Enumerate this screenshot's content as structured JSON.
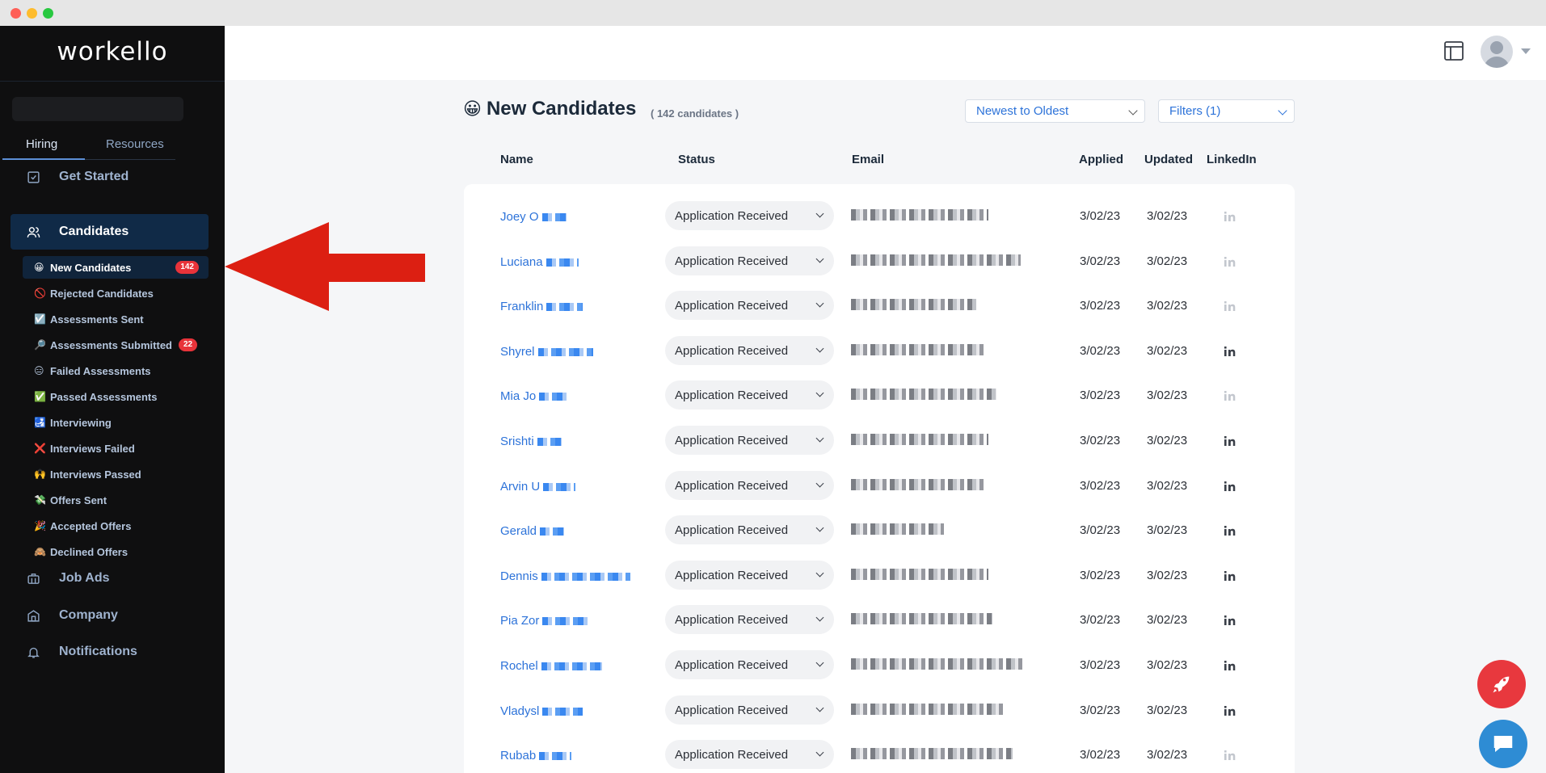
{
  "app": {
    "logo": "workello"
  },
  "sidebar": {
    "tabs": [
      {
        "label": "Hiring",
        "active": true
      },
      {
        "label": "Resources",
        "active": false
      }
    ],
    "nav": {
      "get_started": "Get Started",
      "candidates": "Candidates",
      "job_ads": "Job Ads",
      "company": "Company",
      "notifications": "Notifications"
    },
    "candidate_filters": [
      {
        "emoji": "😀",
        "label": "New Candidates",
        "badge": "142",
        "active": true
      },
      {
        "emoji": "🚫",
        "label": "Rejected Candidates",
        "badge": null
      },
      {
        "emoji": "☑️",
        "label": "Assessments Sent",
        "badge": null
      },
      {
        "emoji": "🔎",
        "label": "Assessments Submitted",
        "badge": "22"
      },
      {
        "emoji": "😑",
        "label": "Failed Assessments",
        "badge": null
      },
      {
        "emoji": "✅",
        "label": "Passed Assessments",
        "badge": null
      },
      {
        "emoji": "🛃",
        "label": "Interviewing",
        "badge": null
      },
      {
        "emoji": "❌",
        "label": "Interviews Failed",
        "badge": null
      },
      {
        "emoji": "🙌",
        "label": "Interviews Passed",
        "badge": null
      },
      {
        "emoji": "💸",
        "label": "Offers Sent",
        "badge": null
      },
      {
        "emoji": "🎉",
        "label": "Accepted Offers",
        "badge": null
      },
      {
        "emoji": "🙈",
        "label": "Declined Offers",
        "badge": null
      }
    ]
  },
  "page": {
    "title_emoji": "😀",
    "title": "New Candidates",
    "count_label": "( 142 candidates )",
    "sort_value": "Newest to Oldest",
    "filters_value": "Filters (1)"
  },
  "table": {
    "headers": {
      "name": "Name",
      "status": "Status",
      "email": "Email",
      "applied": "Applied",
      "updated": "Updated",
      "linkedin": "LinkedIn"
    },
    "rows": [
      {
        "name": "Joey O",
        "status": "Application Received",
        "applied": "3/02/23",
        "updated": "3/02/23",
        "linkedin": false
      },
      {
        "name": "Luciana",
        "status": "Application Received",
        "applied": "3/02/23",
        "updated": "3/02/23",
        "linkedin": false
      },
      {
        "name": "Franklin",
        "status": "Application Received",
        "applied": "3/02/23",
        "updated": "3/02/23",
        "linkedin": false
      },
      {
        "name": "Shyrel",
        "status": "Application Received",
        "applied": "3/02/23",
        "updated": "3/02/23",
        "linkedin": true
      },
      {
        "name": "Mia Jo",
        "status": "Application Received",
        "applied": "3/02/23",
        "updated": "3/02/23",
        "linkedin": false
      },
      {
        "name": "Srishti",
        "status": "Application Received",
        "applied": "3/02/23",
        "updated": "3/02/23",
        "linkedin": true
      },
      {
        "name": "Arvin U",
        "status": "Application Received",
        "applied": "3/02/23",
        "updated": "3/02/23",
        "linkedin": true
      },
      {
        "name": "Gerald",
        "status": "Application Received",
        "applied": "3/02/23",
        "updated": "3/02/23",
        "linkedin": true
      },
      {
        "name": "Dennis",
        "status": "Application Received",
        "applied": "3/02/23",
        "updated": "3/02/23",
        "linkedin": true
      },
      {
        "name": "Pia Zor",
        "status": "Application Received",
        "applied": "3/02/23",
        "updated": "3/02/23",
        "linkedin": true
      },
      {
        "name": "Rochel",
        "status": "Application Received",
        "applied": "3/02/23",
        "updated": "3/02/23",
        "linkedin": true
      },
      {
        "name": "Vladysl",
        "status": "Application Received",
        "applied": "3/02/23",
        "updated": "3/02/23",
        "linkedin": true
      },
      {
        "name": "Rubab",
        "status": "Application Received",
        "applied": "3/02/23",
        "updated": "3/02/23",
        "linkedin": false
      }
    ]
  },
  "colors": {
    "accent_blue": "#2d73d9",
    "sidebar_bg": "#0f0f10",
    "badge_red": "#e8333a",
    "annotation_arrow": "#dc1f12",
    "linkedin_active": "#3a3f48",
    "linkedin_inactive": "#c3c7ce"
  },
  "icons": {
    "get_started": "checkbox-icon",
    "candidates": "users-icon",
    "job_ads": "briefcase-icon",
    "company": "building-icon",
    "notifications": "bell-icon",
    "layout": "layout-icon",
    "rocket": "rocket-icon",
    "chat": "chat-icon"
  }
}
